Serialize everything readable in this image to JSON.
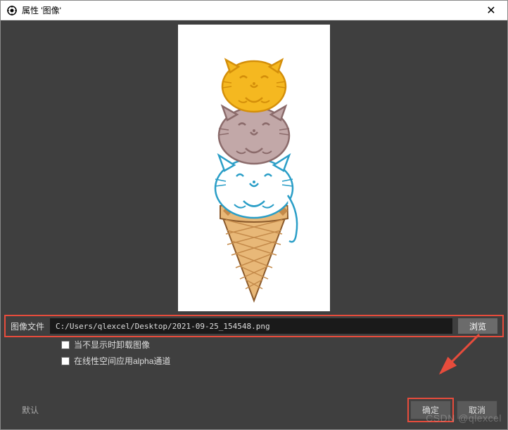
{
  "titlebar": {
    "title": "属性 '图像'"
  },
  "form": {
    "file_label": "图像文件",
    "file_path": "C:/Users/qlexcel/Desktop/2021-09-25_154548.png",
    "browse_label": "浏览",
    "checkbox1_label": "当不显示时卸载图像",
    "checkbox2_label": "在线性空间应用alpha通道"
  },
  "buttons": {
    "defaults": "默认",
    "ok": "确定",
    "cancel": "取消"
  },
  "watermark": "CSDN @qlexcel",
  "colors": {
    "highlight": "#e74c3c",
    "bg_dark": "#3f3f3f",
    "input_bg": "#1a1a1a"
  }
}
